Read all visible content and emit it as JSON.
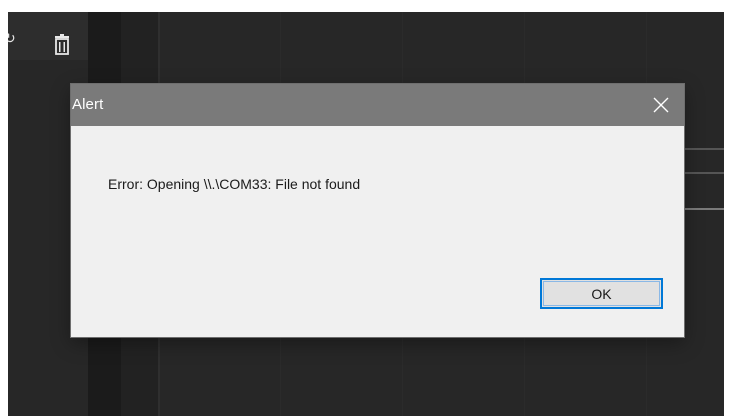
{
  "toolbar": {
    "icons": [
      "refresh-icon",
      "trash-icon"
    ]
  },
  "dialog": {
    "title": "Alert",
    "close_icon": "close-icon",
    "message": "Error: Opening \\\\.\\COM33: File not found",
    "ok_label": "OK"
  },
  "colors": {
    "background": "#272727",
    "titlebar": "#7a7a7a",
    "dialog_body": "#f0f0f0",
    "focus_border": "#0078d7"
  }
}
